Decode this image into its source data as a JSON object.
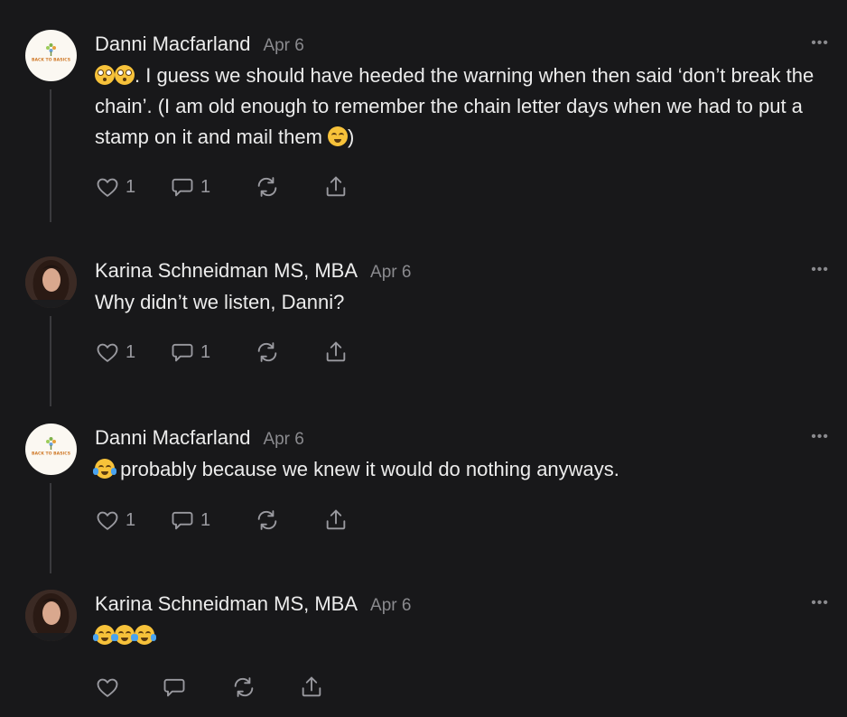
{
  "comments": [
    {
      "author": "Danni Macfarland",
      "date": "Apr 6",
      "avatar_text": "BACK TO BASICS",
      "text_parts": [
        ". I guess we should have heeded the warning when then said ‘don’t break the chain’. (I am old enough to remember the chain letter days when we had to put a stamp on it and mail them ",
        ")"
      ],
      "likes": "1",
      "replies": "1"
    },
    {
      "author": "Karina Schneidman MS, MBA",
      "date": "Apr 6",
      "text": "Why didn’t we listen, Danni?",
      "likes": "1",
      "replies": "1"
    },
    {
      "author": "Danni Macfarland",
      "date": "Apr 6",
      "avatar_text": "BACK TO BASICS",
      "text": " probably because we knew it would do nothing anyways.",
      "likes": "1",
      "replies": "1"
    },
    {
      "author": "Karina Schneidman MS, MBA",
      "date": "Apr 6",
      "text": "",
      "likes": "",
      "replies": ""
    }
  ],
  "more_label": "•••",
  "icons": {
    "like": "heart-icon",
    "reply": "comment-bubble-icon",
    "restack": "restack-icon",
    "share": "share-icon",
    "more": "ellipsis-icon"
  },
  "colors": {
    "background": "#18181a",
    "text": "#ececec",
    "muted": "#8a8a8e",
    "thread_line": "#3a3a3d"
  }
}
